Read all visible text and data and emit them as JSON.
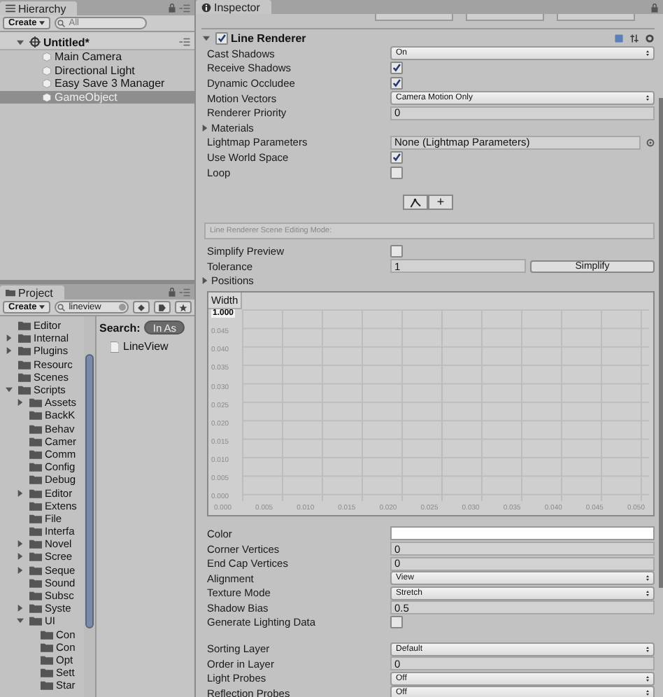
{
  "hierarchy": {
    "tab": "Hierarchy",
    "create": "Create",
    "search_placeholder": "All",
    "scene": {
      "name": "Untitled*",
      "expanded": true
    },
    "items": [
      {
        "name": "Main Camera",
        "selected": false
      },
      {
        "name": "Directional Light",
        "selected": false
      },
      {
        "name": "Easy Save 3 Manager",
        "selected": false
      },
      {
        "name": "GameObject",
        "selected": true
      }
    ]
  },
  "project": {
    "tab": "Project",
    "create": "Create",
    "search_value": "lineview",
    "search_label": "Search:",
    "scope": "In As",
    "tree": [
      {
        "name": "Editor",
        "kind": "leaf"
      },
      {
        "name": "Internal",
        "kind": "branch",
        "expanded": false
      },
      {
        "name": "Plugins",
        "kind": "branch",
        "expanded": false
      },
      {
        "name": "Resourc",
        "kind": "leaf"
      },
      {
        "name": "Scenes",
        "kind": "leaf"
      },
      {
        "name": "Scripts",
        "kind": "branch",
        "expanded": true,
        "children": [
          {
            "name": "Assets",
            "kind": "branch",
            "expanded": false
          },
          {
            "name": "BackK",
            "kind": "leaf"
          },
          {
            "name": "Behav",
            "kind": "leaf"
          },
          {
            "name": "Camer",
            "kind": "leaf"
          },
          {
            "name": "Comm",
            "kind": "leaf"
          },
          {
            "name": "Config",
            "kind": "leaf"
          },
          {
            "name": "Debug",
            "kind": "leaf"
          },
          {
            "name": "Editor",
            "kind": "branch",
            "expanded": false
          },
          {
            "name": "Extens",
            "kind": "leaf"
          },
          {
            "name": "File",
            "kind": "leaf"
          },
          {
            "name": "Interfa",
            "kind": "leaf"
          },
          {
            "name": "Novel",
            "kind": "branch",
            "expanded": false
          },
          {
            "name": "Scree",
            "kind": "branch",
            "expanded": false
          },
          {
            "name": "Seque",
            "kind": "branch",
            "expanded": false
          },
          {
            "name": "Sound",
            "kind": "leaf"
          },
          {
            "name": "Subsc",
            "kind": "leaf"
          },
          {
            "name": "Syste",
            "kind": "branch",
            "expanded": false
          },
          {
            "name": "UI",
            "kind": "branch",
            "expanded": true,
            "children": [
              {
                "name": "Con"
              },
              {
                "name": "Con"
              },
              {
                "name": "Opt"
              },
              {
                "name": "Sett"
              },
              {
                "name": "Star"
              }
            ]
          }
        ]
      }
    ],
    "results": [
      {
        "name": "LineView"
      }
    ]
  },
  "inspector": {
    "tab": "Inspector",
    "component": {
      "name": "Line Renderer",
      "enabled": true,
      "expanded": true
    },
    "rows": [
      {
        "kind": "dropdown",
        "label": "Cast Shadows",
        "value": "On"
      },
      {
        "kind": "checkbox",
        "label": "Receive Shadows",
        "checked": true
      },
      {
        "kind": "checkbox",
        "label": "Dynamic Occludee",
        "checked": true
      },
      {
        "kind": "dropdown",
        "label": "Motion Vectors",
        "value": "Camera Motion Only"
      },
      {
        "kind": "field",
        "label": "Renderer Priority",
        "value": "0"
      },
      {
        "kind": "foldout",
        "label": "Materials",
        "expanded": false
      },
      {
        "kind": "object",
        "label": "Lightmap Parameters",
        "value": "None (Lightmap Parameters)"
      },
      {
        "kind": "checkbox",
        "label": "Use World Space",
        "checked": true
      },
      {
        "kind": "checkbox",
        "label": "Loop",
        "checked": false
      }
    ],
    "edit_buttons": [
      {
        "kind": "curve",
        "selected": false
      },
      {
        "kind": "text",
        "label": "+",
        "selected": false
      }
    ],
    "edit_mode_label": "Line Renderer Scene Editing Mode:",
    "simplify_preview": {
      "label": "Simplify Preview",
      "checked": false
    },
    "tolerance": {
      "label": "Tolerance",
      "value": "1",
      "button": "Simplify"
    },
    "positions": {
      "label": "Positions",
      "expanded": false
    },
    "width_curve": {
      "title": "Width",
      "value": "1.000",
      "y_labels": [
        "0.045",
        "0.040",
        "0.035",
        "0.030",
        "0.025",
        "0.020",
        "0.015",
        "0.010",
        "0.005",
        "0.000"
      ],
      "x_labels": [
        "0.000",
        "0.005",
        "0.010",
        "0.015",
        "0.020",
        "0.025",
        "0.030",
        "0.035",
        "0.040",
        "0.045",
        "0.050"
      ]
    },
    "rows2": [
      {
        "kind": "color",
        "label": "Color",
        "color": "#ffffff"
      },
      {
        "kind": "field",
        "label": "Corner Vertices",
        "value": "0"
      },
      {
        "kind": "field",
        "label": "End Cap Vertices",
        "value": "0"
      },
      {
        "kind": "dropdown",
        "label": "Alignment",
        "value": "View"
      },
      {
        "kind": "dropdown",
        "label": "Texture Mode",
        "value": "Stretch"
      },
      {
        "kind": "field",
        "label": "Shadow Bias",
        "value": "0.5"
      },
      {
        "kind": "checkbox",
        "label": "Generate Lighting Data",
        "checked": false
      },
      {
        "kind": "spacer"
      },
      {
        "kind": "dropdown",
        "label": "Sorting Layer",
        "value": "Default"
      },
      {
        "kind": "field",
        "label": "Order in Layer",
        "value": "0"
      },
      {
        "kind": "dropdown",
        "label": "Light Probes",
        "value": "Off"
      },
      {
        "kind": "dropdown",
        "label": "Reflection Probes",
        "value": "Off"
      }
    ]
  }
}
